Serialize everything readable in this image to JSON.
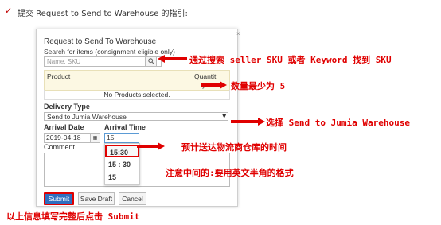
{
  "instruction": {
    "check_mark": "✓",
    "text": "提交 Request to Send to Warehouse 的指引:"
  },
  "dialog": {
    "close_label": "×",
    "title": "Request to Send To Warehouse",
    "search_label": "Search for items (consignment eligible only)",
    "search_placeholder": "Name, SKU",
    "search_icon": "search-icon",
    "table": {
      "columns": [
        "Product",
        "Quantit",
        "y"
      ],
      "empty_text": "No Products selected."
    },
    "delivery_type_label": "Delivery Type",
    "delivery_type_value": "Send to Jumia Warehouse",
    "arrival_date_label": "Arrival Date",
    "arrival_date_value": "2019-04-18",
    "arrival_time_label": "Arrival Time",
    "arrival_time_value": "15",
    "time_options": [
      "15:30",
      "15 : 30",
      "15"
    ],
    "comment_label": "Comment",
    "buttons": {
      "submit": "Submit",
      "save_draft": "Save Draft",
      "cancel": "Cancel"
    }
  },
  "annotations": {
    "search": "通过搜索 seller SKU 或者 Keyword 找到 SKU",
    "quantity": "数量最少为 5",
    "delivery": "选择 Send to Jumia Warehouse",
    "arrival": "预计送达物流商仓库的时间",
    "time_format": "注意中间的:要用英文半角的格式"
  },
  "bottom_note": "以上信息填写完整后点击 Submit",
  "colors": {
    "annotation_red": "#e00000",
    "submit_blue": "#2f6ebf",
    "table_header_bg": "#fcf8e3"
  }
}
